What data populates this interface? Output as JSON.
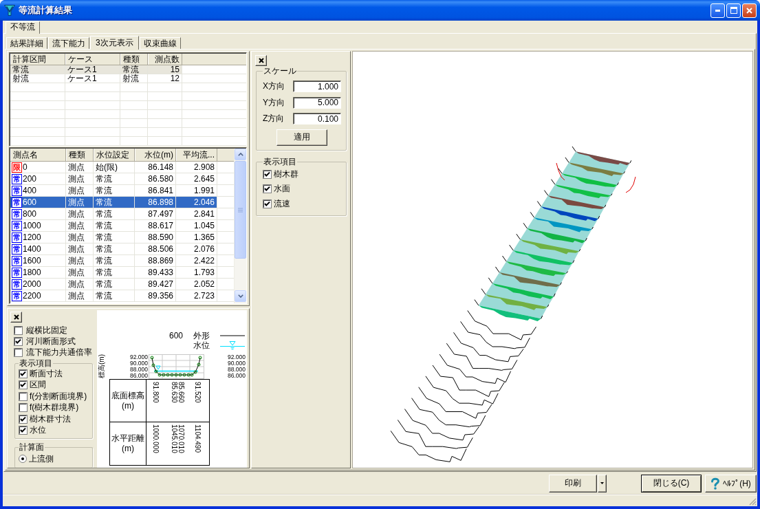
{
  "window": {
    "title": "等流計算結果"
  },
  "outer_tabs": [
    {
      "label": "不等流",
      "selected": true
    }
  ],
  "tabs": [
    {
      "label": "結果詳細",
      "selected": false
    },
    {
      "label": "流下能力",
      "selected": false
    },
    {
      "label": "3次元表示",
      "selected": true
    },
    {
      "label": "収束曲線",
      "selected": false
    }
  ],
  "section_table": {
    "columns": [
      "計算区間",
      "ケース",
      "種類",
      "測点数"
    ],
    "rows": [
      {
        "cells": [
          "常流",
          "ケース1",
          "常流",
          "15"
        ],
        "selected": true
      },
      {
        "cells": [
          "射流",
          "ケース1",
          "射流",
          "12"
        ],
        "selected": false
      }
    ]
  },
  "station_table": {
    "columns": [
      "測点名",
      "種類",
      "水位設定",
      "水位(m)",
      "平均流..."
    ],
    "rows": [
      {
        "badge": "限",
        "color": "#ff0000",
        "cells": [
          "0",
          "測点",
          "始(限)",
          "86.148",
          "2.908"
        ],
        "selected": false
      },
      {
        "badge": "常",
        "color": "#0000ff",
        "cells": [
          "200",
          "測点",
          "常流",
          "86.580",
          "2.645"
        ],
        "selected": false
      },
      {
        "badge": "常",
        "color": "#0000ff",
        "cells": [
          "400",
          "測点",
          "常流",
          "86.841",
          "1.991"
        ],
        "selected": false
      },
      {
        "badge": "常",
        "color": "#0000ff",
        "cells": [
          "600",
          "測点",
          "常流",
          "86.898",
          "2.046"
        ],
        "selected": true
      },
      {
        "badge": "常",
        "color": "#0000ff",
        "cells": [
          "800",
          "測点",
          "常流",
          "87.497",
          "2.841"
        ],
        "selected": false
      },
      {
        "badge": "常",
        "color": "#0000ff",
        "cells": [
          "1000",
          "測点",
          "常流",
          "88.617",
          "1.045"
        ],
        "selected": false
      },
      {
        "badge": "常",
        "color": "#0000ff",
        "cells": [
          "1200",
          "測点",
          "常流",
          "88.590",
          "1.365"
        ],
        "selected": false
      },
      {
        "badge": "常",
        "color": "#0000ff",
        "cells": [
          "1400",
          "測点",
          "常流",
          "88.506",
          "2.076"
        ],
        "selected": false
      },
      {
        "badge": "常",
        "color": "#0000ff",
        "cells": [
          "1600",
          "測点",
          "常流",
          "88.869",
          "2.422"
        ],
        "selected": false
      },
      {
        "badge": "常",
        "color": "#0000ff",
        "cells": [
          "1800",
          "測点",
          "常流",
          "89.433",
          "1.793"
        ],
        "selected": false
      },
      {
        "badge": "常",
        "color": "#0000ff",
        "cells": [
          "2000",
          "測点",
          "常流",
          "89.427",
          "2.052"
        ],
        "selected": false
      },
      {
        "badge": "常",
        "color": "#0000ff",
        "cells": [
          "2200",
          "測点",
          "常流",
          "89.356",
          "2.723"
        ],
        "selected": false
      }
    ]
  },
  "section_view": {
    "options": [
      {
        "label": "縦横比固定",
        "checked": false
      },
      {
        "label": "河川断面形式",
        "checked": true
      },
      {
        "label": "流下能力共通倍率",
        "checked": false
      }
    ],
    "display_group": {
      "title": "表示項目",
      "items": [
        {
          "label": "断面寸法",
          "checked": true
        },
        {
          "label": "区間",
          "checked": true
        },
        {
          "label": "f(分割断面境界)",
          "checked": false
        },
        {
          "label": "f(樹木群境界)",
          "checked": false
        },
        {
          "label": "樹木群寸法",
          "checked": true
        },
        {
          "label": "水位",
          "checked": true
        }
      ]
    },
    "calc_group": {
      "title": "計算面",
      "options": [
        {
          "label": "上流側",
          "selected": true
        }
      ]
    },
    "station": "600",
    "legend": [
      {
        "label": "外形",
        "kind": "outline"
      },
      {
        "label": "水位",
        "kind": "water"
      }
    ],
    "y_label": "標高(m)",
    "left_ticks": [
      "92.000",
      "90.000",
      "88.000",
      "86.000"
    ],
    "right_ticks": [
      "92.000",
      "90.000",
      "88.000",
      "86.000"
    ],
    "profile_rows": [
      {
        "label": "底面標高\n(m)",
        "values": [
          "91.800",
          "85.630",
          "85.660",
          "91.520"
        ]
      },
      {
        "label": "水平距離\n(m)",
        "values": [
          "1000.000",
          "1045.010",
          "1070.010",
          "1104.490"
        ]
      }
    ]
  },
  "view_settings": {
    "scale": {
      "title": "スケール",
      "fields": [
        {
          "label": "X方向",
          "value": "1.000"
        },
        {
          "label": "Y方向",
          "value": "5.000"
        },
        {
          "label": "Z方向",
          "value": "0.100"
        }
      ],
      "apply": "適用"
    },
    "display": {
      "title": "表示項目",
      "items": [
        {
          "label": "樹木群",
          "checked": true
        },
        {
          "label": "水面",
          "checked": true
        },
        {
          "label": "流速",
          "checked": true
        }
      ]
    }
  },
  "buttons": [
    {
      "label": "印刷",
      "kind": "split"
    },
    {
      "label": "閉じる(C)",
      "kind": "default"
    },
    {
      "label": "ﾍﾙﾌﾟ(H)",
      "kind": "help"
    }
  ]
}
